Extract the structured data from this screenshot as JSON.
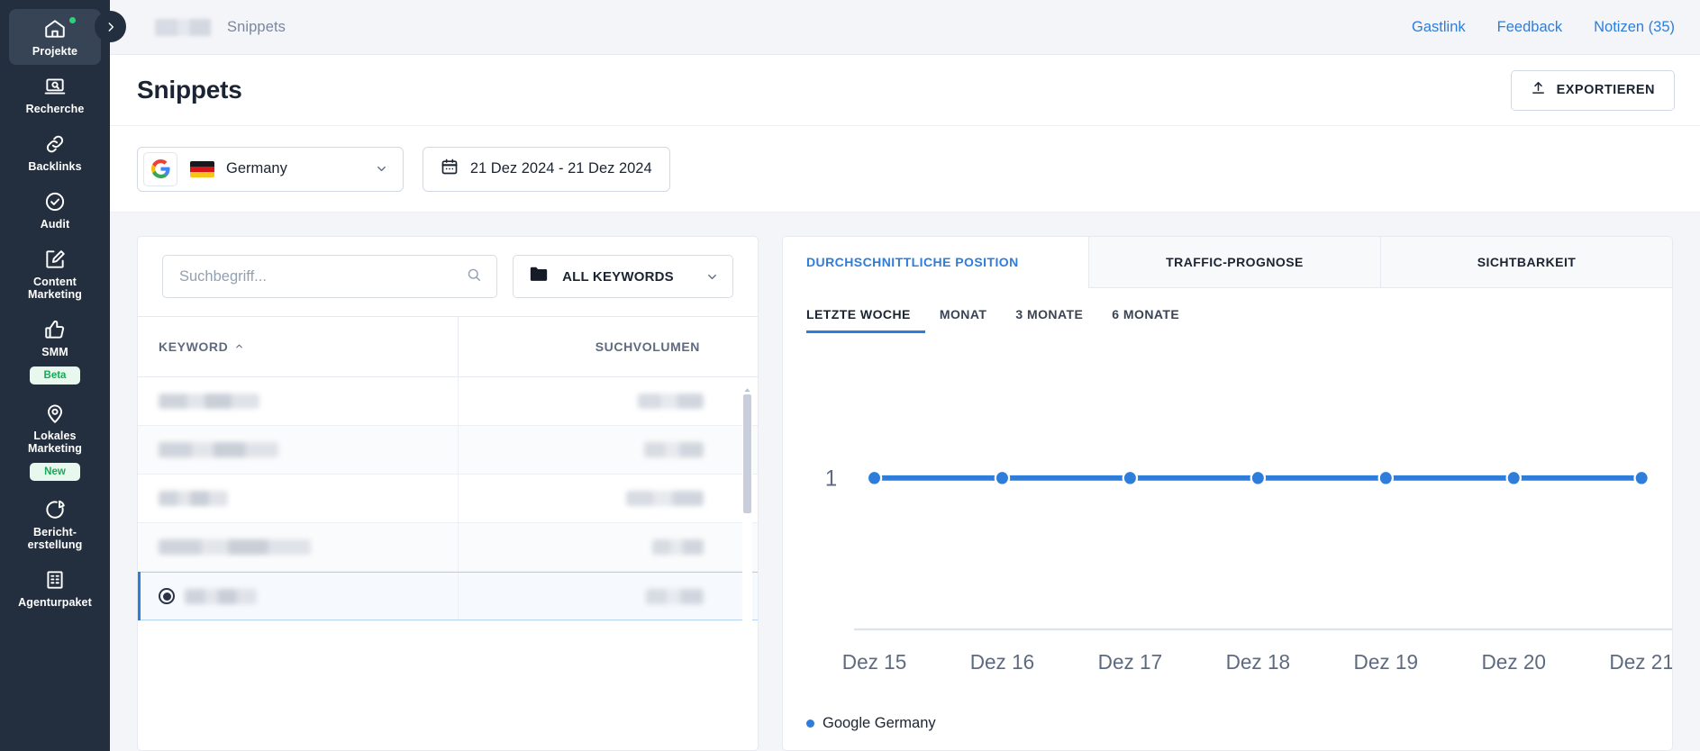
{
  "sidebar": {
    "items": [
      {
        "label": "Projekte",
        "icon": "home-icon",
        "active": true,
        "dot": true,
        "badge": null
      },
      {
        "label": "Recherche",
        "icon": "laptop-search-icon",
        "active": false,
        "dot": false,
        "badge": null
      },
      {
        "label": "Backlinks",
        "icon": "link-icon",
        "active": false,
        "dot": false,
        "badge": null
      },
      {
        "label": "Audit",
        "icon": "check-circle-icon",
        "active": false,
        "dot": false,
        "badge": null
      },
      {
        "label": "Content Marketing",
        "icon": "edit-square-icon",
        "active": false,
        "dot": false,
        "badge": null
      },
      {
        "label": "SMM",
        "icon": "thumbs-up-icon",
        "active": false,
        "dot": false,
        "badge": "Beta"
      },
      {
        "label": "Lokales Marketing",
        "icon": "location-pin-icon",
        "active": false,
        "dot": false,
        "badge": "New"
      },
      {
        "label": "Bericht-erstellung",
        "icon": "pie-chart-icon",
        "active": false,
        "dot": false,
        "badge": null
      },
      {
        "label": "Agenturpaket",
        "icon": "building-icon",
        "active": false,
        "dot": false,
        "badge": null
      }
    ],
    "collapse_icon": "chevron-right-icon"
  },
  "topbar": {
    "breadcrumb_project_hidden": "",
    "breadcrumb_current": "Snippets",
    "links": [
      {
        "label": "Gastlink"
      },
      {
        "label": "Feedback"
      },
      {
        "label": "Notizen (35)"
      }
    ]
  },
  "page": {
    "title": "Snippets",
    "export_label": "EXPORTIEREN",
    "export_icon": "upload-icon"
  },
  "filters": {
    "engine_icon": "google-icon",
    "country_flag": "germany-flag-icon",
    "country": "Germany",
    "country_caret": "chevron-down-icon",
    "calendar_icon": "calendar-icon",
    "date_range": "21 Dez 2024 - 21 Dez 2024"
  },
  "keywords_panel": {
    "search_placeholder": "Suchbegriff...",
    "search_value": "",
    "search_icon": "search-icon",
    "folder_icon": "folder-icon",
    "folder_label": "ALL KEYWORDS",
    "folder_caret": "chevron-down-icon",
    "columns": [
      {
        "label": "KEYWORD",
        "sort_icon": "caret-up-icon"
      },
      {
        "label": "SUCHVOLUMEN",
        "sort_icon": null
      }
    ],
    "rows": [
      {
        "keyword_redacted": true,
        "keyword_width": 112,
        "volume_redacted": true,
        "volume_width": 73,
        "selected": false
      },
      {
        "keyword_redacted": true,
        "keyword_width": 133,
        "volume_redacted": true,
        "volume_width": 66,
        "selected": false
      },
      {
        "keyword_redacted": true,
        "keyword_width": 77,
        "volume_redacted": true,
        "volume_width": 86,
        "selected": false
      },
      {
        "keyword_redacted": true,
        "keyword_width": 169,
        "volume_redacted": true,
        "volume_width": 57,
        "selected": false
      },
      {
        "keyword_redacted": true,
        "keyword_width": 80,
        "volume_redacted": true,
        "volume_width": 64,
        "selected": true
      }
    ],
    "scrollbar": {
      "up_icon": "caret-up-icon"
    }
  },
  "chart_panel": {
    "tabs": [
      {
        "label": "DURCHSCHNITTLICHE POSITION",
        "active": true
      },
      {
        "label": "TRAFFIC-PROGNOSE",
        "active": false
      },
      {
        "label": "SICHTBARKEIT",
        "active": false
      }
    ],
    "ranges": [
      {
        "label": "LETZTE WOCHE",
        "active": true
      },
      {
        "label": "MONAT",
        "active": false
      },
      {
        "label": "3 MONATE",
        "active": false
      },
      {
        "label": "6 MONATE",
        "active": false
      }
    ],
    "legend": [
      {
        "label": "Google Germany",
        "color": "#2f7ddb"
      }
    ]
  },
  "chart_data": {
    "type": "line",
    "title": "DURCHSCHNITTLICHE POSITION",
    "xlabel": "",
    "ylabel": "",
    "x": [
      "Dez 15",
      "Dez 16",
      "Dez 17",
      "Dez 18",
      "Dez 19",
      "Dez 20",
      "Dez 21"
    ],
    "ytick_labels": [
      "1"
    ],
    "ylim": [
      1,
      1
    ],
    "grid": false,
    "legend_position": "bottom-left",
    "series": [
      {
        "name": "Google Germany",
        "color": "#2f7ddb",
        "values": [
          1,
          1,
          1,
          1,
          1,
          1,
          1
        ]
      }
    ]
  },
  "colors": {
    "sidebar_bg": "#232f3e",
    "accent": "#2f7ddb",
    "badge_green": "#18a957",
    "page_bg": "#f3f5f9"
  }
}
